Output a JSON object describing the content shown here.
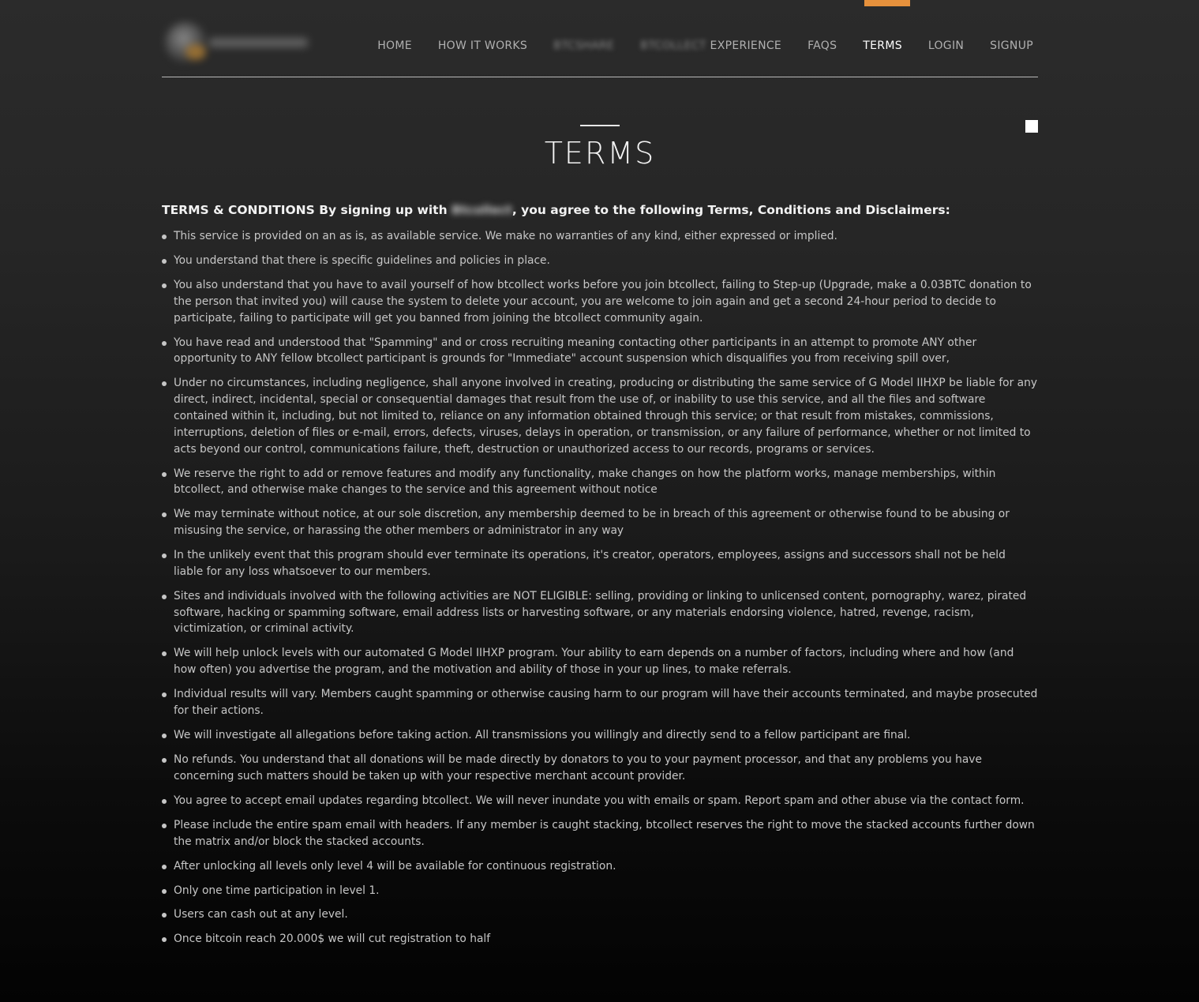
{
  "nav": {
    "items": [
      {
        "label": "HOME",
        "blurred_prefix": "",
        "active": false
      },
      {
        "label": "HOW IT WORKS",
        "blurred_prefix": "",
        "active": false
      },
      {
        "label": "",
        "blurred_prefix": "BTCSHARE",
        "active": false
      },
      {
        "label": "EXPERIENCE",
        "blurred_prefix": "BTCOLLECT",
        "active": false
      },
      {
        "label": "FAQS",
        "blurred_prefix": "",
        "active": false
      },
      {
        "label": "TERMS",
        "blurred_prefix": "",
        "active": true
      },
      {
        "label": "LOGIN",
        "blurred_prefix": "",
        "active": false
      },
      {
        "label": "SIGNUP",
        "blurred_prefix": "",
        "active": false
      }
    ],
    "active_color": "#e6913c"
  },
  "page": {
    "title": "TERMS"
  },
  "intro": {
    "prefix": "TERMS & CONDITIONS By signing up with ",
    "site_name_blurred": "Btcollect",
    "suffix": ", you agree to the following Terms, Conditions and Disclaimers:"
  },
  "terms": [
    "This service is provided on an as is, as available service. We make no warranties of any kind, either expressed or implied.",
    "You understand that there is specific guidelines and policies in place.",
    "You also understand that you have to avail yourself of how btcollect works before you join btcollect, failing to Step-up (Upgrade, make a 0.03BTC donation to the person that invited you) will cause the system to delete your account, you are welcome to join again and get a second 24-hour period to decide to participate, failing to participate will get you banned from joining the btcollect community again.",
    "You have read and understood that \"Spamming\" and or cross recruiting meaning contacting other participants in an attempt to promote ANY other opportunity to ANY fellow btcollect participant is grounds for \"Immediate\" account suspension which disqualifies you from receiving spill over,",
    "Under no circumstances, including negligence, shall anyone involved in creating, producing or distributing the same service of G Model IIHXP be liable for any direct, indirect, incidental, special or consequential damages that result from the use of, or inability to use this service, and all the files and software contained within it, including, but not limited to, reliance on any information obtained through this service; or that result from mistakes, commissions, interruptions, deletion of files or e-mail, errors, defects, viruses, delays in operation, or transmission, or any failure of performance, whether or not limited to acts beyond our control, communications failure, theft, destruction or unauthorized access to our records, programs or services.",
    "We reserve the right to add or remove features and modify any functionality, make changes on how the platform works, manage memberships, within btcollect, and otherwise make changes to the service and this agreement without notice",
    "We may terminate without notice, at our sole discretion, any membership deemed to be in breach of this agreement or otherwise found to be abusing or misusing the service, or harassing the other members or administrator in any way",
    "In the unlikely event that this program should ever terminate its operations, it's creator, operators, employees, assigns and successors shall not be held liable for any loss whatsoever to our members.",
    "Sites and individuals involved with the following activities are NOT ELIGIBLE: selling, providing or linking to unlicensed content, pornography, warez, pirated software, hacking or spamming software, email address lists or harvesting software, or any materials endorsing violence, hatred, revenge, racism, victimization, or criminal activity.",
    "We will help unlock levels with our automated G Model IIHXP program. Your ability to earn depends on a number of factors, including where and how (and how often) you advertise the program, and the motivation and ability of those in your up lines, to make referrals.",
    "Individual results will vary. Members caught spamming or otherwise causing harm to our program will have their accounts terminated, and maybe prosecuted for their actions.",
    "We will investigate all allegations before taking action. All transmissions you willingly and directly send to a fellow participant are final.",
    "No refunds. You understand that all donations will be made directly by donators to you to your payment processor, and that any problems you have concerning such matters should be taken up with your respective merchant account provider.",
    "You agree to accept email updates regarding btcollect. We will never inundate you with emails or spam. Report spam and other abuse via the contact form.",
    "Please include the entire spam email with headers. If any member is caught stacking, btcollect reserves the right to move the stacked accounts further down the matrix and/or block the stacked accounts.",
    "After unlocking all levels only level 4 will be available for continuous registration.",
    "Only one time participation in level 1.",
    "Users can cash out at any level.",
    "Once bitcoin reach 20.000$ we will cut registration to half"
  ]
}
